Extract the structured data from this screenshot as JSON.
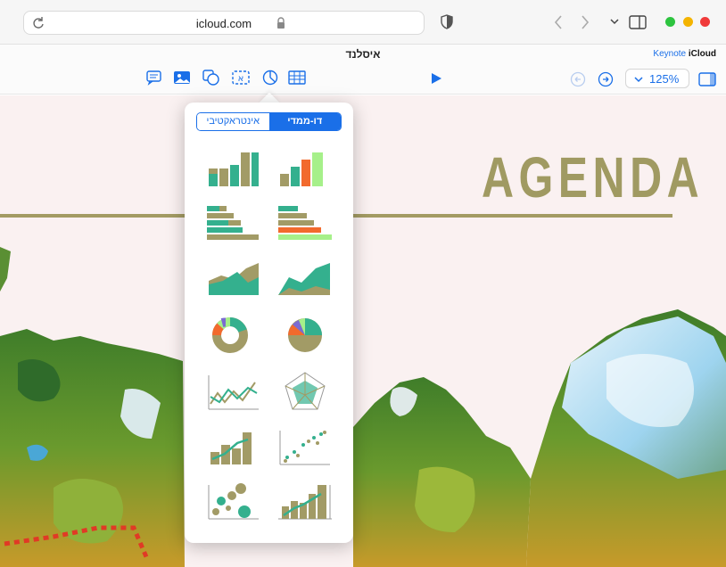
{
  "browser": {
    "url": "icloud.com",
    "icons": [
      "reload-icon",
      "lock-icon",
      "shield-icon",
      "back-icon",
      "forward-icon",
      "chevron-down-icon",
      "sidebar-icon"
    ],
    "traffic_lights": {
      "green": "#2dc43f",
      "yellow": "#f4b400",
      "red": "#f03a3a"
    }
  },
  "app": {
    "doc_title": "איסלנד",
    "brand_app": "Keynote",
    "brand_name": "iCloud",
    "toolbar_icons": [
      "comment-icon",
      "media-icon",
      "shape-icon",
      "textbox-icon",
      "chart-icon",
      "table-icon",
      "play-icon"
    ],
    "zoom": "125%",
    "accent": "#1a6fe8"
  },
  "slide": {
    "title": "AGENDA",
    "title_color": "#a09a62"
  },
  "chart_popover": {
    "tabs": {
      "interactive": "אינטראקטיבי",
      "two_d": "דו-ממדי"
    },
    "selected_tab": "two_d",
    "chart_types": [
      "column-chart",
      "stacked-column-chart",
      "bar-chart",
      "stacked-bar-chart",
      "area-chart",
      "stacked-area-chart",
      "donut-chart",
      "pie-chart",
      "line-chart",
      "radar-chart",
      "mixed-chart",
      "scatter-chart",
      "bubble-chart",
      "two-axis-chart"
    ]
  }
}
